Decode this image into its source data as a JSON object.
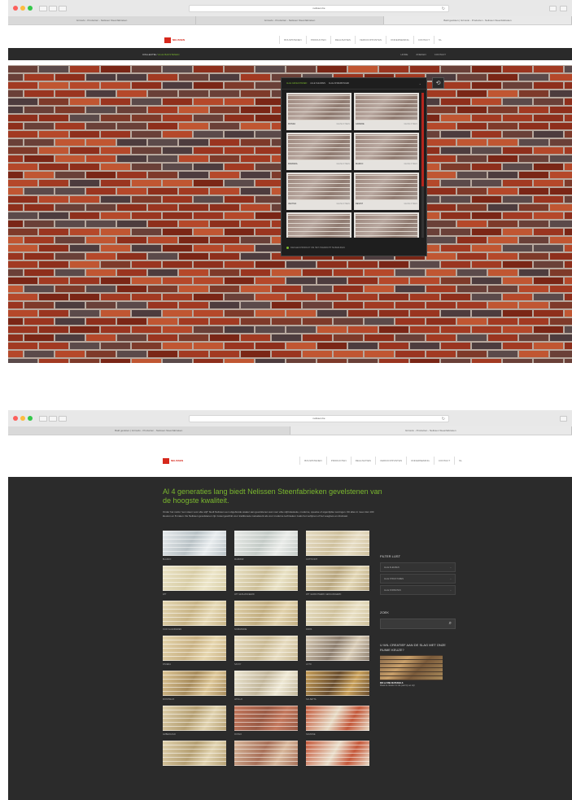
{
  "colors": {
    "accent": "#7bb92e",
    "brand_red": "#d6281c",
    "dark_bg": "#2b2b2b"
  },
  "top": {
    "url": "nelissen.be",
    "tabs": [
      "Grinsvlo - Producten - Nelissen Steenfabrieken",
      "Grinsvlo - Producten - Nelissen Steenfabrieken",
      "Bald gesloten | Grinsvlo - Producten - Nelissen Steenfabrieken"
    ],
    "logo": "NELISSEN",
    "nav": [
      "BOUWSTENEN",
      "PRODUCTEN",
      "REALISATIES",
      "VERKOOPPUNTEN",
      "ONDERNEMING",
      "CONTACT",
      "NL"
    ],
    "breadcrumb_prefix": "COLLECTIE /",
    "breadcrumb_current": "ALLE BAKSTENEN",
    "subnav": [
      "HOME",
      "ZOEKEN",
      "CONTACT"
    ],
    "selector_tabs": [
      "ALLE GEVELSTENEN",
      "ALLE KLEUREN",
      "ALLE AFWERKINGEN"
    ],
    "selector_cards": [
      {
        "name": "MONZA",
        "code": "GEVELSTEEN"
      },
      {
        "name": "GRANDE",
        "code": "GEVELSTEEN"
      },
      {
        "name": "MIRANDA",
        "code": "GEVELSTEEN"
      },
      {
        "name": "MARCO",
        "code": "GEVELSTEEN"
      },
      {
        "name": "VECTRA",
        "code": "GEVELSTEEN"
      },
      {
        "name": "RESIST",
        "code": "GEVELSTEEN"
      },
      {
        "name": "SAVO",
        "code": "GEVELSTEEN"
      },
      {
        "name": "SIENA",
        "code": "GEVELSTEEN"
      }
    ],
    "selector_footer": "KIES EEN PRODUCT OM HET OVERZICHT TE BEKIJKEN",
    "tool_icon": "refresh-icon"
  },
  "bottom": {
    "url": "nelissen.be",
    "tabs": [
      "Bald gesloten | Grinsvlo - Producten - Nelissen Steenfabrieken",
      "Grinsvlo - Producten - Nelissen Steenfabrieken"
    ],
    "logo": "NELISSEN",
    "nav": [
      "BOUWSTENEN",
      "PRODUCTEN",
      "REALISATIES",
      "VERKOOPPUNTEN",
      "ONDERNEMING",
      "CONTACT",
      "NL"
    ],
    "hero_title": "Al 4 generaties lang biedt Nelissen Steenfabrieken gevelstenen van de hoogste kwaliteit.",
    "hero_text": "Onder het motto \"een steen voor elke stijl\" biedt Nelissen een uitgebreide waaier aan gevelstenen aan voor elke stijl klassieke, moderne, speelse of eigentijdse woningen. Dit alles in meer dan 100 kleuren en 8 maten. De Nelissen gevelstenen zijn zowel geschikt voor traditionele metselwerk als voor moderne technieken zoals het verlijmen of het voegloos en drukvast.",
    "bricks": [
      {
        "name": "BLANCO",
        "c1": "#e8ecee",
        "c2": "#b9c2c6"
      },
      {
        "name": "MARMOR",
        "c1": "#e9ebe8",
        "c2": "#c4cbc7"
      },
      {
        "name": "COTTO WIT",
        "c1": "#e6dcc3",
        "c2": "#cfc19e"
      },
      {
        "name": "WIT",
        "c1": "#ece5c8",
        "c2": "#d8cda6"
      },
      {
        "name": "WIT GENUANCEERD",
        "c1": "#e9e2c5",
        "c2": "#cdbf98"
      },
      {
        "name": "WIT GEFRUITEERD GENUANCEERD",
        "c1": "#e2d6b4",
        "c2": "#b9a780"
      },
      {
        "name": "OUD VLAANDEREN",
        "c1": "#e5d8b4",
        "c2": "#c8b486"
      },
      {
        "name": "NORMANDIE",
        "c1": "#e2d3ad",
        "c2": "#c2ae81"
      },
      {
        "name": "PARIS",
        "c1": "#e8dfc3",
        "c2": "#cfc19c"
      },
      {
        "name": "RIVIERA",
        "c1": "#e6d6ae",
        "c2": "#c9b284"
      },
      {
        "name": "SAVOY",
        "c1": "#e7dcc0",
        "c2": "#c9b993"
      },
      {
        "name": "LOTO",
        "c1": "#d8cbb5",
        "c2": "#8e7f6f"
      },
      {
        "name": "MONTREUX",
        "c1": "#ddc798",
        "c2": "#a88c5c"
      },
      {
        "name": "APOLLO",
        "c1": "#eee8d4",
        "c2": "#c2b69a"
      },
      {
        "name": "SALSETTA",
        "c1": "#c9a15b",
        "c2": "#6a4e2e"
      },
      {
        "name": "AMBERGOLD",
        "c1": "#e0d2ae",
        "c2": "#b59f72"
      },
      {
        "name": "ROSSO",
        "c1": "#c4795e",
        "c2": "#9a5a44"
      },
      {
        "name": "SAVANNE",
        "c1": "#c45a3c",
        "c2": "#e6d9c3"
      },
      {
        "name": "",
        "c1": "#e0d2ae",
        "c2": "#b59f72"
      },
      {
        "name": "",
        "c1": "#d8b89c",
        "c2": "#a87058"
      },
      {
        "name": "",
        "c1": "#c65a3c",
        "c2": "#e8dcc8"
      }
    ],
    "filter_title": "FILTER LIJST",
    "filters": [
      "ALLE KLEUREN",
      "ALLE STRUCTUREN",
      "ALLE FORMATEN"
    ],
    "search_title": "ZOEK",
    "search_icon": "search-icon",
    "promo_title": "U WIL CREATIEF AAN DE SLAG MET ONZE RUIME KEUZE?",
    "promo_caption1": "MIX & FINE MATERIALS",
    "promo_caption2": "Maak de ideale mix die past bij uw stijl"
  }
}
